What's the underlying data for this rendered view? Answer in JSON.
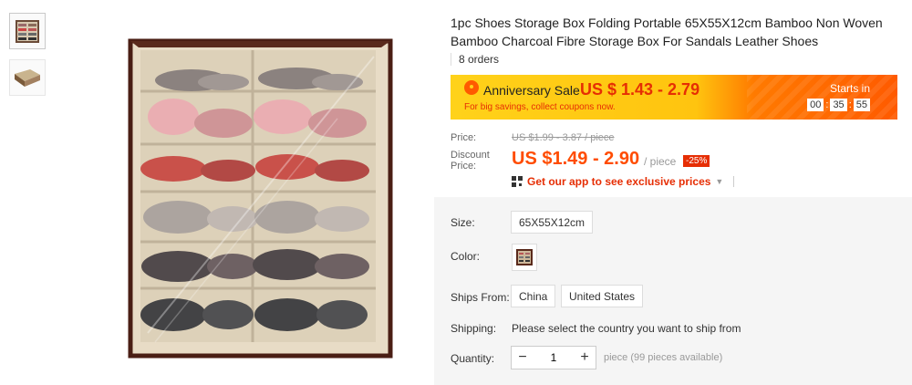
{
  "product": {
    "title": "1pc Shoes Storage Box Folding Portable 65X55X12cm Bamboo Non Woven Bamboo Charcoal Fibre Storage Box For Sandals Leather Shoes",
    "orders": "8 orders"
  },
  "promo": {
    "name": "Anniversary Sale",
    "price": "US $ 1.43 - 2.79",
    "subtitle": "For big savings, collect coupons now.",
    "starts_label": "Starts in",
    "timer": [
      "00",
      "35",
      "55"
    ],
    "colors": {
      "primary": "#ffcf14",
      "accent": "#ff5a00",
      "price": "#e62e04"
    }
  },
  "pricing": {
    "price_label": "Price:",
    "original": "US $1.99 - 3.87 / piece",
    "discount_label": "Discount Price:",
    "discount_price": "US $1.49 - 2.90",
    "per_piece": "/ piece",
    "percent_off": "-25%",
    "app_promo": "Get our app to see exclusive prices"
  },
  "options": {
    "size_label": "Size:",
    "size_value": "65X55X12cm",
    "color_label": "Color:",
    "ships_from_label": "Ships From:",
    "ships_from": [
      "China",
      "United States"
    ],
    "shipping_label": "Shipping:",
    "shipping_text": "Please select the country you want to ship from",
    "quantity_label": "Quantity:",
    "quantity_value": "1",
    "quantity_note": "piece (99 pieces available)"
  },
  "icons": {
    "sale": "sale-badge-icon",
    "qr": "qr-code-icon",
    "caret": "caret-down-icon",
    "minus": "minus-icon",
    "plus": "plus-icon"
  }
}
